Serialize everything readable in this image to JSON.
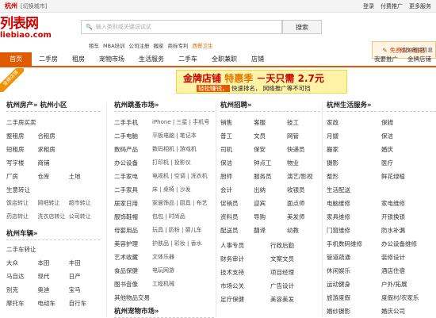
{
  "topbar": {
    "city": "杭州",
    "switch": "[切换城市]",
    "login": "登录",
    "promote": "付费推广",
    "more": "更多服务"
  },
  "logo": {
    "main": "列表网",
    "sub": "liebiao.com"
  },
  "search": {
    "placeholder": "输入类别或关键词试试",
    "button": "搜索"
  },
  "post_button": "免费发布信息",
  "hotlinks": [
    "租车",
    "MBA培训",
    "公司注册",
    "搬家",
    "商标专利",
    "西餐卫生"
  ],
  "region_link": "修改/删除信息",
  "nav": {
    "items": [
      "首页",
      "二手房",
      "租房",
      "宠物市场",
      "生活服务",
      "二手车",
      "全职兼职",
      "店铺"
    ],
    "right": [
      "我要推广",
      "金牌店铺"
    ]
  },
  "corner_badge": "金牌店铺",
  "ad": {
    "title_a": "金牌店铺",
    "title_b": "特惠季",
    "title_c": "－天只需",
    "price": "2.7元",
    "sub_a": "轻松赚钱，",
    "sub_b": "快速排名，",
    "sub_c": "网络推广等不可挡"
  },
  "col1": {
    "title": "杭州房产» 杭州小区",
    "items": [
      "二手房买卖",
      "",
      "",
      "整租房",
      "合租房",
      "",
      "短租房",
      "求租房",
      "",
      "写字楼",
      "商铺",
      "",
      "厂房",
      "仓库",
      "土地"
    ],
    "sub_title": "生意转让",
    "subs": [
      "饭店转让",
      "网吧转让",
      "超市转让",
      "药店转让",
      "洗衣店转让",
      "公司转让"
    ],
    "car_title": "杭州车辆»",
    "car_sub": "二手车转让",
    "cars": [
      "大众",
      "本田",
      "丰田",
      "马自达",
      "现代",
      "日产",
      "别克",
      "奥迪",
      "宝马",
      "摩托车",
      "电动车",
      "自行车"
    ]
  },
  "col2": {
    "title": "杭州跳蚤市场»",
    "rows": [
      [
        "二手手机",
        "iPhone | 三星 | 手机号"
      ],
      [
        "二手电脑",
        "平板电脑 | 笔记本"
      ],
      [
        "数码产品",
        "数码相机 | 游戏机"
      ],
      [
        "办公设备",
        "打印机 | 投影仪"
      ],
      [
        "二手家电",
        "电视机 | 空调 | 洗衣机"
      ],
      [
        "二手家具",
        "床 | 桌椅 | 沙发"
      ],
      [
        "居家日用",
        "家居饰品 | 厨具 | 布艺"
      ],
      [
        "服饰鞋帽",
        "包包 | 时尚品"
      ],
      [
        "母婴用品",
        "玩具 | 奶粉 | 婴儿车"
      ],
      [
        "美容护理",
        "护肤品 | 彩妆 | 香水"
      ],
      [
        "艺术收藏",
        "文体乐器"
      ],
      [
        "食品保健",
        "电玩网游"
      ],
      [
        "图书音像",
        "工程机械"
      ],
      [
        "其他物品交易",
        ""
      ]
    ],
    "next": "杭州宠物市场»"
  },
  "col3": {
    "title": "杭州招聘»",
    "items": [
      "销售",
      "客服",
      "技工",
      "普工",
      "文员",
      "网管",
      "司机",
      "保安",
      "快递员",
      "保洁",
      "钟点工",
      "物业",
      "厨师",
      "服务员",
      "演艺/影视",
      "会计",
      "出纳",
      "收银员",
      "促销员",
      "迎宾",
      "面点师",
      "资料员",
      "导购",
      "美发师",
      "配送员",
      "翻译",
      "幼教",
      "驾驶",
      "护士"
    ],
    "more": [
      "人事专员",
      "行政后勤",
      "财务审计",
      "文案文员",
      "技术支持",
      "项目经理",
      "市场公关",
      "广告设计",
      "足疗保健",
      "美容美发"
    ]
  },
  "col4": {
    "title": "杭州生活服务»",
    "items": [
      "家政",
      "保姆",
      "月嫂",
      "保洁",
      "搬家",
      "婚庆",
      "摄影",
      "医疗",
      "整形",
      "鲜花绿植"
    ],
    "sub": "生活配送",
    "items2": [
      "电脑维修",
      "家电维修",
      "家具维修",
      "开锁换锁",
      "门窗维修",
      "防水补漏",
      "手机数码维修",
      "办公设备维修",
      "管道疏通",
      "装修设计",
      "休闲娱乐",
      "酒店住宿",
      "运动健身",
      "户外/拓展",
      "旅游度假",
      "度假村/农家乐",
      "婚纱摄影",
      "婚庆公司"
    ]
  }
}
